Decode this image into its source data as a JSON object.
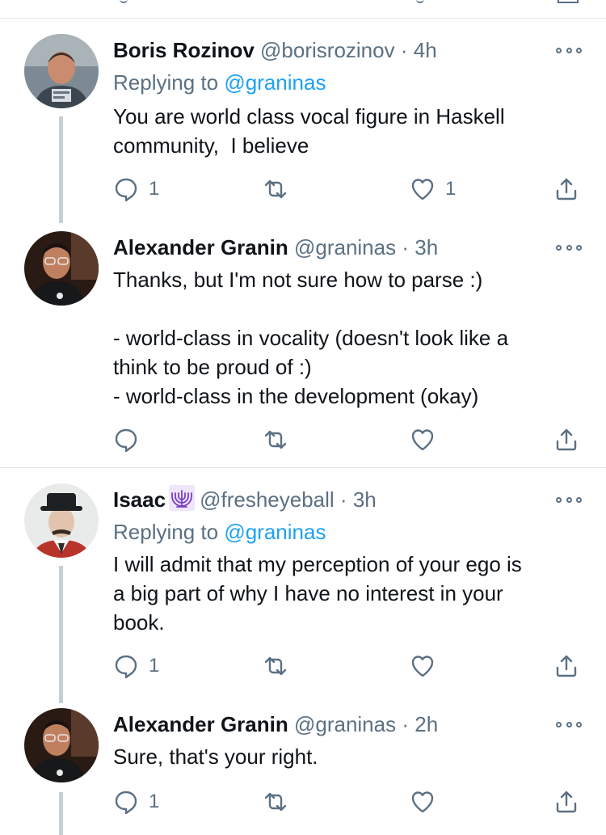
{
  "colors": {
    "text": "#0f1419",
    "secondary": "#5b7083",
    "link": "#1da1f2",
    "divider": "#e1e8ed",
    "thread_line": "#c4cfd6"
  },
  "icons": {
    "reply": "reply-icon",
    "retweet": "retweet-icon",
    "like": "heart-icon",
    "share": "share-icon",
    "more": "more-options-icon"
  },
  "tweets": [
    {
      "name": "Boris Rozinov",
      "handle": "@borisrozinov",
      "dot": "·",
      "time": "4h",
      "replying_prefix": "Replying to",
      "replying_to": "@graninas",
      "text": "You are world class vocal figure in Haskell\ncommunity,  I believe",
      "reply_count": "1",
      "retweet_count": "",
      "like_count": "1"
    },
    {
      "name": "Alexander Granin",
      "handle": "@graninas",
      "dot": "·",
      "time": "3h",
      "text": "Thanks, but I'm not sure how to parse :)\n\n- world-class in vocality (doesn't look like a\nthink to be proud of :)\n- world-class in the development (okay)",
      "reply_count": "",
      "retweet_count": "",
      "like_count": ""
    },
    {
      "name": "Isaac",
      "handle": "@fresheyeball",
      "dot": "·",
      "time": "3h",
      "emoji": "menorah-icon",
      "replying_prefix": "Replying to",
      "replying_to": "@graninas",
      "text": "I will admit that my perception of your ego is\na big part of why I have no interest in your\nbook.",
      "reply_count": "1",
      "retweet_count": "",
      "like_count": ""
    },
    {
      "name": "Alexander Granin",
      "handle": "@graninas",
      "dot": "·",
      "time": "2h",
      "text": "Sure, that's your right.",
      "reply_count": "1",
      "retweet_count": "",
      "like_count": ""
    }
  ]
}
